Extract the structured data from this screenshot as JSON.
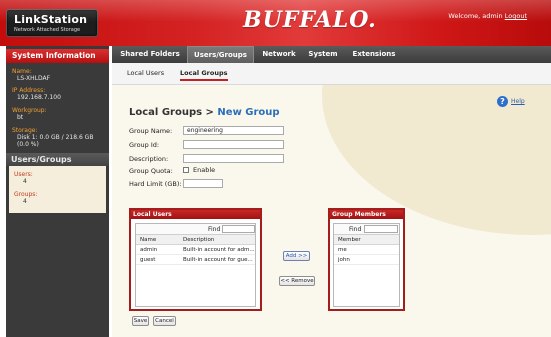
{
  "header": {
    "product_title": "LinkStation",
    "product_subtitle": "Network Attached Storage",
    "brand": "BUFFALO.",
    "welcome_text": "Welcome, admin",
    "logout_label": "Logout"
  },
  "sidebar": {
    "system_info_title": "System Information",
    "name_label": "Name:",
    "name_value": "LS-XHLDAF",
    "ip_label": "IP Address:",
    "ip_value": "192.168.7.100",
    "workgroup_label": "Workgroup:",
    "workgroup_value": "bt",
    "storage_label": "Storage:",
    "storage_value_1": "Disk 1: 0.0 GB / 218.6 GB",
    "storage_value_2": "(0.0 %)",
    "users_groups_title": "Users/Groups",
    "users_label": "Users:",
    "users_value": "4",
    "groups_label": "Groups:",
    "groups_value": "4"
  },
  "nav": {
    "tabs": [
      "Shared Folders",
      "Users/Groups",
      "Network",
      "System",
      "Extensions"
    ],
    "active_tab": "Users/Groups"
  },
  "subnav": {
    "tabs": [
      "Local Users",
      "Local Groups"
    ],
    "active_tab": "Local Groups"
  },
  "main": {
    "title_prefix": "Local Groups > ",
    "title_accent": "New Group",
    "help_label": "Help",
    "form": {
      "group_name_label": "Group Name:",
      "group_name_value": "engineering",
      "group_id_label": "Group Id:",
      "group_id_value": "",
      "description_label": "Description:",
      "description_value": "",
      "group_quota_label": "Group Quota:",
      "group_quota_option": "Enable",
      "group_quota_checked": false,
      "hard_limit_label": "Hard Limit (GB):",
      "hard_limit_value": ""
    },
    "local_users": {
      "title": "Local Users",
      "find_label": "Find",
      "columns": [
        "Name",
        "Description"
      ],
      "rows": [
        {
          "name": "admin",
          "description": "Built-in account for adm..."
        },
        {
          "name": "guest",
          "description": "Built-in account for gue..."
        }
      ]
    },
    "group_members": {
      "title": "Group Members",
      "find_label": "Find",
      "columns": [
        "Member"
      ],
      "rows": [
        {
          "member": "me"
        },
        {
          "member": "john"
        }
      ]
    },
    "add_label": "Add >>",
    "remove_label": "<< Remove",
    "save_label": "Save",
    "cancel_label": "Cancel"
  },
  "colors": {
    "brand_red": "#c40c0c",
    "sidebar_dark": "#3a3a3a",
    "accent_blue": "#2a6fb8",
    "sidebar_label_orange": "#f0a030"
  }
}
